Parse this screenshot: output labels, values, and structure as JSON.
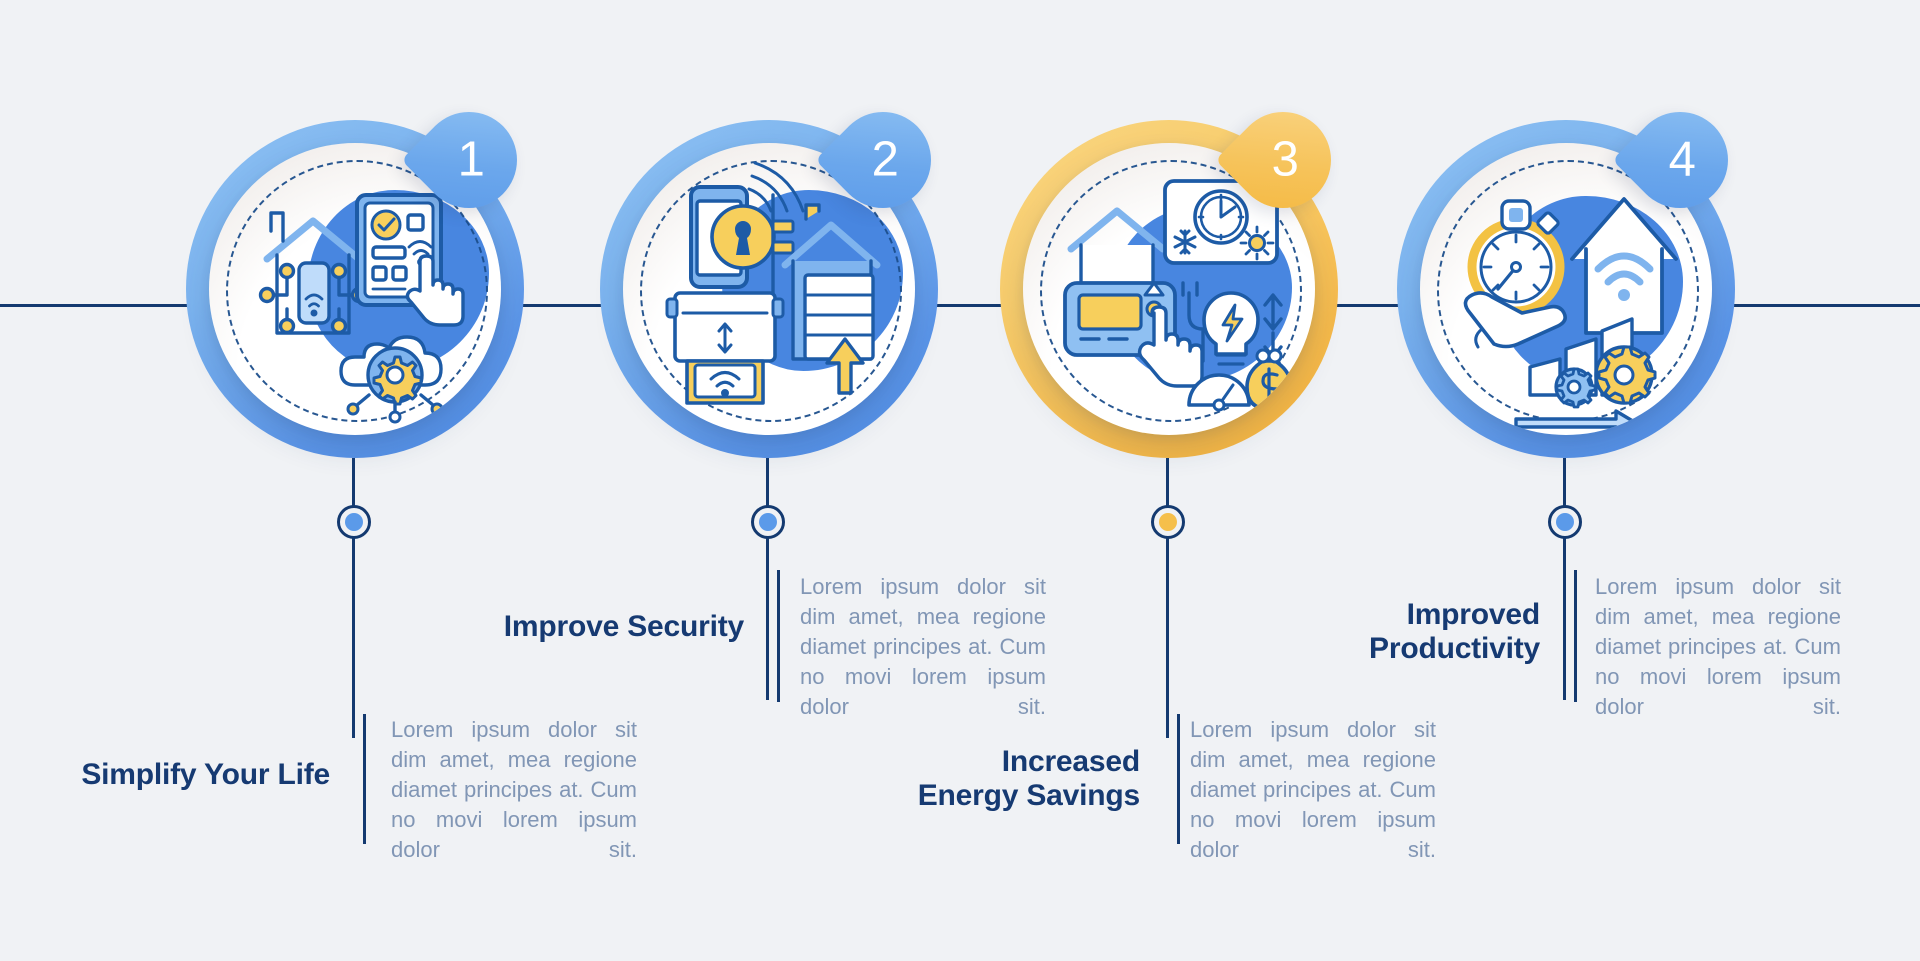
{
  "theme": {
    "background": "#f0f2f5",
    "navy": "#143a70",
    "heading_color": "#163a72",
    "body_color": "#8196b5",
    "blue": "#5b9ae9",
    "amber": "#f5bf4b"
  },
  "items": [
    {
      "number": "1",
      "badge_color": "blue",
      "dot_color": "blue",
      "ring_color": "blue",
      "heading": "Simplify Your Life",
      "body": "Lorem ipsum dolor sit dim amet, mea regione diamet principes at. Cum no movi lorem ipsum dolor sit.",
      "icon_name": "smart-home-automation-icon"
    },
    {
      "number": "2",
      "badge_color": "blue",
      "dot_color": "blue",
      "ring_color": "blue",
      "heading": "Improve Security",
      "body": "Lorem ipsum dolor sit dim amet, mea regione diamet principes at. Cum no movi lorem ipsum dolor sit.",
      "icon_name": "smart-lock-garage-icon"
    },
    {
      "number": "3",
      "badge_color": "amber",
      "dot_color": "amber",
      "ring_color": "amber",
      "heading": "Increased\nEnergy Savings",
      "heading_line1": "Increased",
      "heading_line2": "Energy Savings",
      "body": "Lorem ipsum dolor sit dim amet, mea regione diamet principes at. Cum no movi lorem ipsum dolor sit.",
      "icon_name": "thermostat-energy-savings-icon"
    },
    {
      "number": "4",
      "badge_color": "blue",
      "dot_color": "blue",
      "ring_color": "blue",
      "heading": "Improved\nProductivity",
      "heading_line1": "Improved",
      "heading_line2": "Productivity",
      "body": "Lorem ipsum dolor sit dim amet, mea regione diamet principes at. Cum no movi lorem ipsum dolor sit.",
      "icon_name": "stopwatch-growth-gears-icon"
    }
  ]
}
